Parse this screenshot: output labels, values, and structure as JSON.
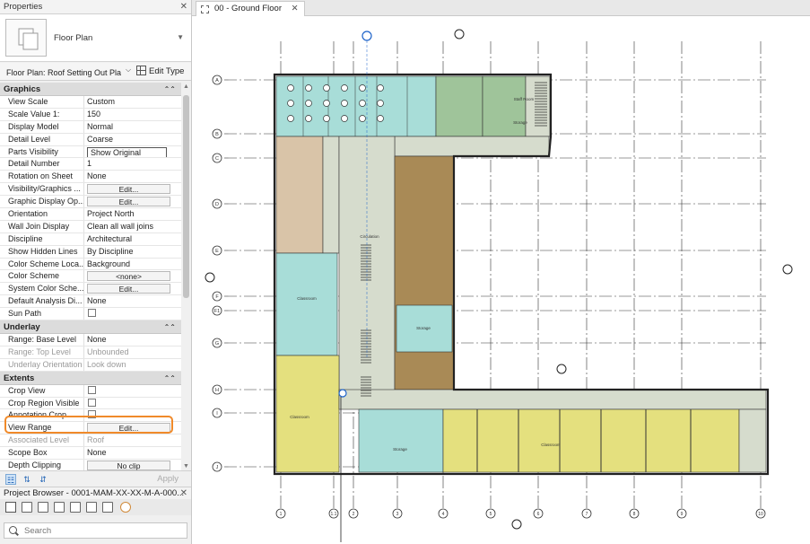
{
  "properties": {
    "panel_title": "Properties",
    "type_name": "Floor Plan",
    "instance_selector": "Floor Plan: Roof Setting Out Pla",
    "edit_type_label": "Edit Type",
    "groups": {
      "graphics": "Graphics",
      "underlay": "Underlay",
      "extents": "Extents"
    },
    "graphics_rows": [
      {
        "key": "View Scale",
        "value": "Custom"
      },
      {
        "key": "Scale Value    1:",
        "value": "150"
      },
      {
        "key": "Display Model",
        "value": "Normal"
      },
      {
        "key": "Detail Level",
        "value": "Coarse"
      },
      {
        "key": "Parts Visibility",
        "value": "Show Original"
      },
      {
        "key": "Detail Number",
        "value": "1"
      },
      {
        "key": "Rotation on Sheet",
        "value": "None"
      },
      {
        "key": "Visibility/Graphics ...",
        "value": "Edit..."
      },
      {
        "key": "Graphic Display Op...",
        "value": "Edit..."
      },
      {
        "key": "Orientation",
        "value": "Project North"
      },
      {
        "key": "Wall Join Display",
        "value": "Clean all wall joins"
      },
      {
        "key": "Discipline",
        "value": "Architectural"
      },
      {
        "key": "Show Hidden Lines",
        "value": "By Discipline"
      },
      {
        "key": "Color Scheme Loca...",
        "value": "Background"
      },
      {
        "key": "Color Scheme",
        "value": "<none>"
      },
      {
        "key": "System Color Sche...",
        "value": "Edit..."
      },
      {
        "key": "Default Analysis Di...",
        "value": "None"
      },
      {
        "key": "Sun Path",
        "value": ""
      }
    ],
    "underlay_rows": [
      {
        "key": "Range: Base Level",
        "value": "None"
      },
      {
        "key": "Range: Top Level",
        "value": "Unbounded"
      },
      {
        "key": "Underlay Orientation",
        "value": "Look down"
      }
    ],
    "extents_rows": [
      {
        "key": "Crop View",
        "value": ""
      },
      {
        "key": "Crop Region Visible",
        "value": ""
      },
      {
        "key": "Annotation Crop",
        "value": ""
      },
      {
        "key": "View Range",
        "value": "Edit..."
      },
      {
        "key": "Associated Level",
        "value": "Roof"
      },
      {
        "key": "Scope Box",
        "value": "None"
      },
      {
        "key": "Depth Clipping",
        "value": "No clip"
      }
    ],
    "apply_label": "Apply"
  },
  "project_browser": {
    "title": "Project Browser - 0001-MAM-XX-XX-M-A-000...",
    "search_placeholder": "Search"
  },
  "view_tab": {
    "label": "00 - Ground Floor"
  },
  "plan": {
    "grid_rows": [
      "A",
      "B",
      "C",
      "D",
      "E",
      "F",
      "F1",
      "G",
      "H",
      "I",
      "J"
    ],
    "grid_cols": [
      "1",
      "1.1",
      "2",
      "3",
      "4",
      "5",
      "6",
      "7",
      "8",
      "9",
      "10"
    ],
    "room_tags": [
      "Circulation",
      "Staff Room",
      "Storage",
      "Classroom",
      "Storage",
      "Classroom",
      "Classroom",
      "Storage"
    ]
  },
  "colors": {
    "highlight": "#f08a2a",
    "teal_room": "#a8ddd8",
    "green_room": "#9fc49a",
    "tan_room": "#d9c4a8",
    "brown_room": "#a98a56",
    "yellow_room": "#e4e07e",
    "circulation": "#d6dccd"
  }
}
